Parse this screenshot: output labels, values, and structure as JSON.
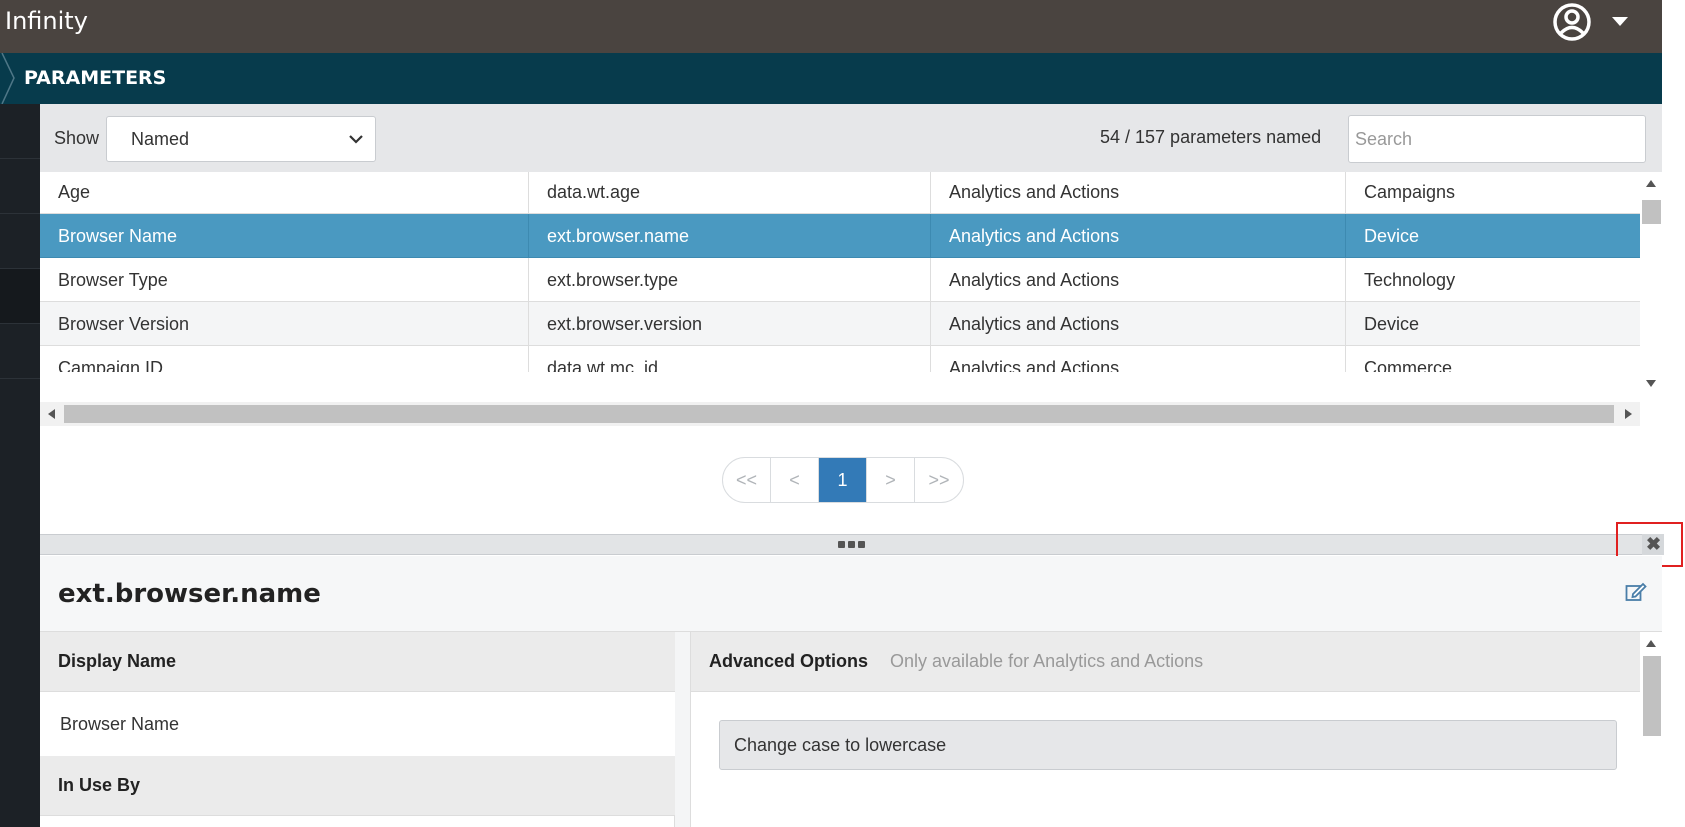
{
  "app": {
    "title": "Infinity",
    "user_icon": "user-circle-icon"
  },
  "breadcrumb": {
    "title": "PARAMETERS"
  },
  "filter": {
    "show_label": "Show",
    "show_value": "Named",
    "count_text": "54 / 157 parameters named",
    "search_placeholder": "Search"
  },
  "table": {
    "rows": [
      {
        "c1": "Age",
        "c2": "data.wt.age",
        "c3": "Analytics and Actions",
        "c4": "Campaigns",
        "selected": false
      },
      {
        "c1": "Browser Name",
        "c2": "ext.browser.name",
        "c3": "Analytics and Actions",
        "c4": "Device",
        "selected": true
      },
      {
        "c1": "Browser Type",
        "c2": "ext.browser.type",
        "c3": "Analytics and Actions",
        "c4": "Technology",
        "selected": false
      },
      {
        "c1": "Browser Version",
        "c2": "ext.browser.version",
        "c3": "Analytics and Actions",
        "c4": "Device",
        "selected": false
      },
      {
        "c1": "Campaign ID",
        "c2": "data.wt.mc_id",
        "c3": "Analytics and Actions",
        "c4": "Commerce",
        "selected": false
      }
    ]
  },
  "pagination": {
    "first": "<<",
    "prev": "<",
    "current": "1",
    "next": ">",
    "last": ">>"
  },
  "detail": {
    "title": "ext.browser.name",
    "display_name_label": "Display Name",
    "display_name_value": "Browser Name",
    "in_use_label": "In Use By",
    "advanced_title": "Advanced Options",
    "advanced_subtitle": "Only available for Analytics and Actions",
    "option_label": "Change case to lowercase",
    "close_glyph": "✖"
  },
  "colors": {
    "topbar": "#4a4440",
    "crumbbar": "#073b4c",
    "selected_row": "#4a99c1",
    "active_page": "#337ab7",
    "highlight": "#e02020"
  }
}
